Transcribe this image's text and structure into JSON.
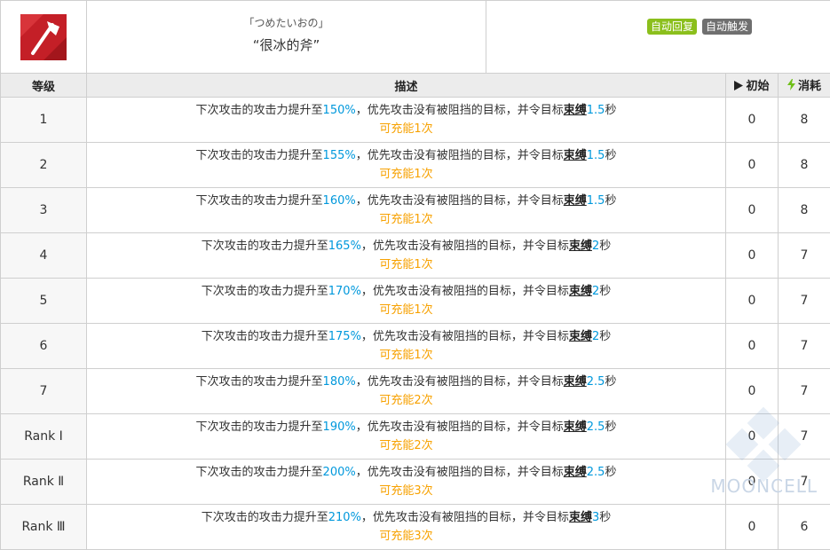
{
  "skill": {
    "jp_name": "「つめたいおの」",
    "cn_name": "“很冰的斧”",
    "icon": "axe-icon",
    "tags": [
      {
        "label": "自动回复",
        "color": "#8bbf1c"
      },
      {
        "label": "自动触发",
        "color": "#6f6f6f"
      }
    ]
  },
  "columns": {
    "level": "等级",
    "description": "描述",
    "initial": "初始",
    "cost": "消耗"
  },
  "desc_text": {
    "part1": "下次攻击的攻击力提升至",
    "part2": "，优先攻击没有被阻挡的目标，并令目标",
    "keyword": "束缚",
    "sec_unit": "秒"
  },
  "rows": [
    {
      "level": "1",
      "atk": "150%",
      "bind": "1.5",
      "charges": "可充能1次",
      "initial": "0",
      "cost": "8"
    },
    {
      "level": "2",
      "atk": "155%",
      "bind": "1.5",
      "charges": "可充能1次",
      "initial": "0",
      "cost": "8"
    },
    {
      "level": "3",
      "atk": "160%",
      "bind": "1.5",
      "charges": "可充能1次",
      "initial": "0",
      "cost": "8"
    },
    {
      "level": "4",
      "atk": "165%",
      "bind": "2",
      "charges": "可充能1次",
      "initial": "0",
      "cost": "7"
    },
    {
      "level": "5",
      "atk": "170%",
      "bind": "2",
      "charges": "可充能1次",
      "initial": "0",
      "cost": "7"
    },
    {
      "level": "6",
      "atk": "175%",
      "bind": "2",
      "charges": "可充能1次",
      "initial": "0",
      "cost": "7"
    },
    {
      "level": "7",
      "atk": "180%",
      "bind": "2.5",
      "charges": "可充能2次",
      "initial": "0",
      "cost": "7"
    },
    {
      "level": "Rank Ⅰ",
      "atk": "190%",
      "bind": "2.5",
      "charges": "可充能2次",
      "initial": "0",
      "cost": "7"
    },
    {
      "level": "Rank Ⅱ",
      "atk": "200%",
      "bind": "2.5",
      "charges": "可充能3次",
      "initial": "0",
      "cost": "7"
    },
    {
      "level": "Rank Ⅲ",
      "atk": "210%",
      "bind": "3",
      "charges": "可充能3次",
      "initial": "0",
      "cost": "6"
    }
  ],
  "watermark": "MOONCELL",
  "colors": {
    "highlight": "#0098dc",
    "charges": "#f7a100",
    "energy": "#6fbf1a"
  }
}
